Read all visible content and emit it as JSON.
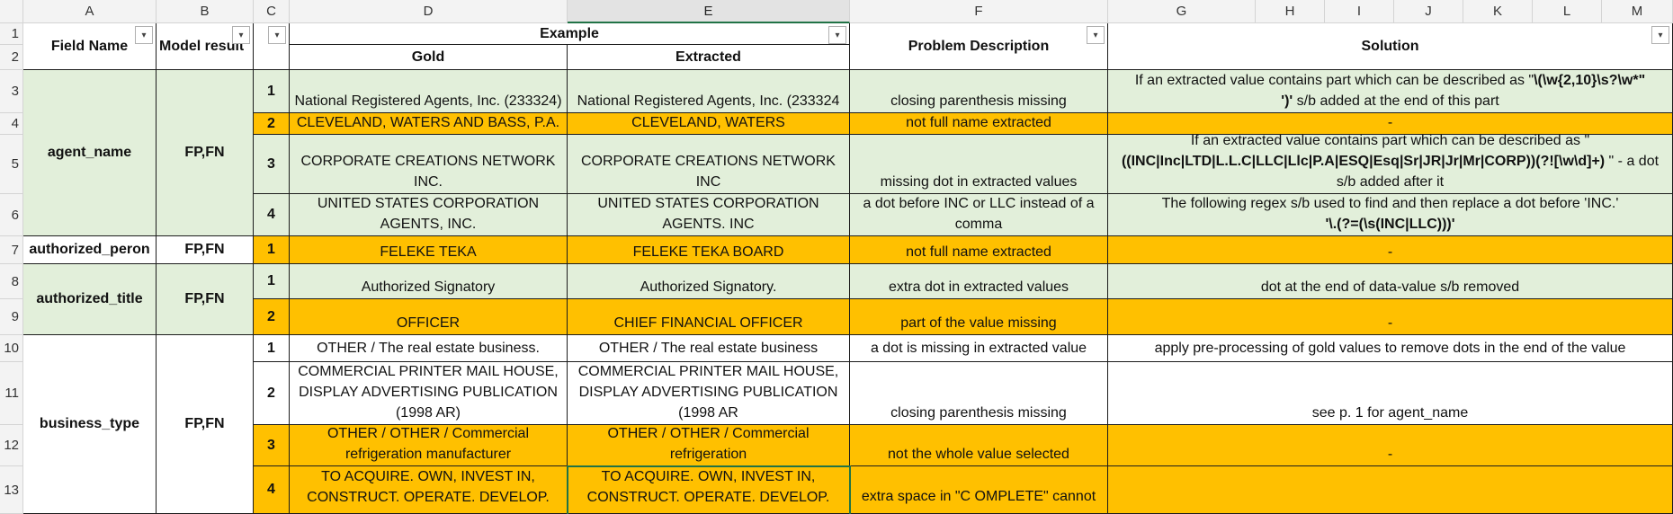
{
  "columns": [
    "A",
    "B",
    "C",
    "D",
    "E",
    "F",
    "G",
    "H",
    "I",
    "J",
    "K",
    "L",
    "M"
  ],
  "rows": [
    "1",
    "2",
    "3",
    "4",
    "5",
    "6",
    "7",
    "8",
    "9",
    "10",
    "11",
    "12",
    "13"
  ],
  "header": {
    "field_name": "Field Name",
    "model_result": "Model result",
    "example": "Example",
    "gold": "Gold",
    "extracted": "Extracted",
    "problem_description": "Problem Description",
    "solution": "Solution",
    "filter_glyph": "▾"
  },
  "groups": [
    {
      "field": "agent_name",
      "result": "FP,FN"
    },
    {
      "field": "authorized_peron",
      "result": "FP,FN"
    },
    {
      "field": "authorized_title",
      "result": "FP,FN"
    },
    {
      "field": "business_type",
      "result": "FP,FN"
    }
  ],
  "entries": [
    {
      "num": "1",
      "gold": "National Registered Agents, Inc. (233324)",
      "extracted": "National Registered Agents, Inc. (233324",
      "problem": "closing parenthesis missing",
      "solution_pre": "If an extracted value contains part which can be described as \"",
      "solution_regex": "\\(\\w{2,10}\\s?\\w*\"",
      "solution_mid": "",
      "solution_regex2": "')'",
      "solution_post": " s/b added at the end of this part"
    },
    {
      "num": "2",
      "gold": "CLEVELAND, WATERS AND BASS, P.A.",
      "extracted": "CLEVELAND, WATERS",
      "problem": "not full name extracted",
      "solution": "-"
    },
    {
      "num": "3",
      "gold": "CORPORATE CREATIONS NETWORK INC.",
      "extracted": "CORPORATE CREATIONS NETWORK INC",
      "problem": "missing dot in extracted values",
      "solution_pre": "If an extracted value contains part which can be described as \"",
      "solution_regex": "((INC|Inc|LTD|L.L.C|LLC|Llc|P.A|ESQ|Esq|Sr|JR|Jr|Mr|CORP))(?![\\w\\d]+)",
      "solution_post": " \" - a dot s/b added after it"
    },
    {
      "num": "4",
      "gold": "UNITED STATES CORPORATION AGENTS, INC.",
      "extracted": "UNITED STATES CORPORATION AGENTS. INC",
      "problem": "a dot before INC or LLC instead of a comma",
      "solution_pre": "The following regex s/b used to find and then replace a dot before 'INC.'",
      "solution_regex": "'\\.(?=(\\s(INC|LLC)))'"
    },
    {
      "num": "1",
      "gold": "FELEKE TEKA",
      "extracted": "FELEKE TEKA BOARD",
      "problem": "not full name extracted",
      "solution": "-"
    },
    {
      "num": "1",
      "gold": "Authorized Signatory",
      "extracted": "Authorized Signatory.",
      "problem": "extra dot in extracted values",
      "solution": "dot at the end of data-value s/b removed"
    },
    {
      "num": "2",
      "gold": "OFFICER",
      "extracted": "CHIEF FINANCIAL OFFICER",
      "problem": "part of the value missing",
      "solution": "-"
    },
    {
      "num": "1",
      "gold": "OTHER / The real estate business.",
      "extracted": "OTHER / The real estate business",
      "problem": "a dot is missing in extracted value",
      "solution": "apply pre-processing of gold values to remove dots in the end of the value"
    },
    {
      "num": "2",
      "gold": "COMMERCIAL PRINTER MAIL HOUSE, DISPLAY ADVERTISING PUBLICATION (1998 AR)",
      "extracted": "COMMERCIAL PRINTER MAIL HOUSE, DISPLAY ADVERTISING PUBLICATION (1998 AR",
      "problem": "closing parenthesis missing",
      "solution": "see p. 1 for agent_name"
    },
    {
      "num": "3",
      "gold": "OTHER / OTHER / Commercial refrigeration manufacturer",
      "extracted": "OTHER / OTHER / Commercial refrigeration",
      "problem": "not the whole value selected",
      "solution": "-"
    },
    {
      "num": "4",
      "gold": "TO ACQUIRE. OWN, INVEST IN, CONSTRUCT. OPERATE. DEVELOP.",
      "extracted": "TO ACQUIRE. OWN, INVEST IN, CONSTRUCT. OPERATE. DEVELOP.",
      "problem": "extra space in \"C OMPLETE\" cannot",
      "solution": ""
    }
  ],
  "colors": {
    "green": "#e2efda",
    "orange": "#ffc000",
    "selection": "#217346"
  }
}
